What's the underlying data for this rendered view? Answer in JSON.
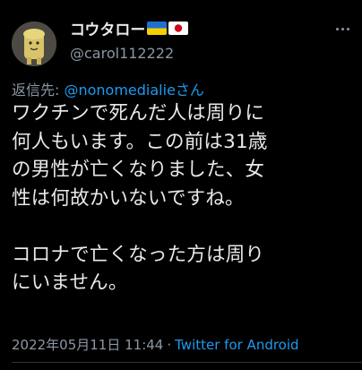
{
  "author": {
    "name": "コウタロー",
    "handle": "@carol112222",
    "flags": [
      "ukraine-flag",
      "japan-flag"
    ],
    "avatar_icon": "toast-character-avatar"
  },
  "reply": {
    "prefix": "返信先: ",
    "target": "@nonomedialieさん"
  },
  "tweet": {
    "lines": [
      "ワクチンで死んだ人は周りに",
      "何人もいます。この前は31歳",
      "の男性が亡くなりました、女",
      "性は何故かいないですね。",
      "",
      "コロナで亡くなった方は周り",
      "にいません。"
    ]
  },
  "meta": {
    "timestamp": "2022年05月11日 11:44",
    "separator": "·",
    "source": "Twitter for Android"
  },
  "colors": {
    "background": "#000000",
    "text": "#e7e9ea",
    "secondary": "#8b98a5",
    "link": "#1d9bf0"
  }
}
